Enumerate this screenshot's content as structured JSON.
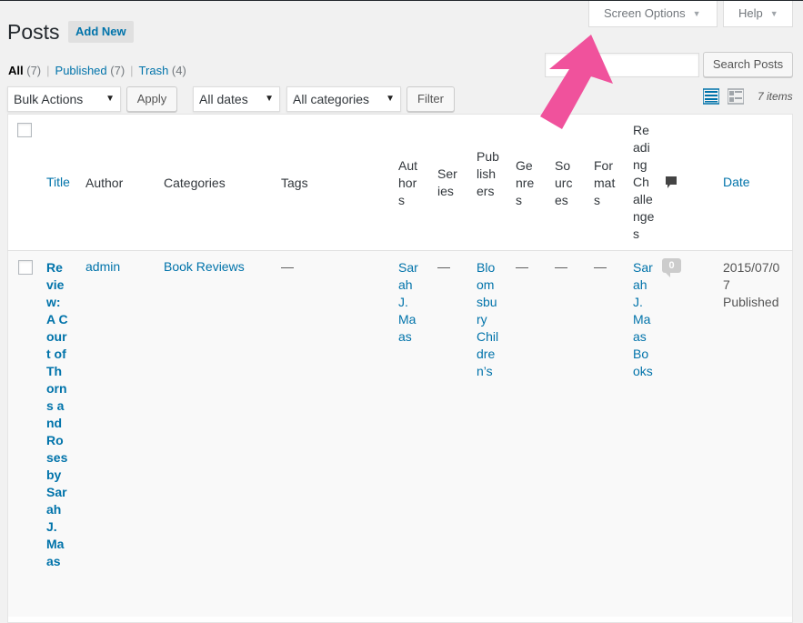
{
  "header": {
    "title": "Posts",
    "add_new": "Add New",
    "screen_options": "Screen Options",
    "help": "Help"
  },
  "filters": {
    "all": "All",
    "all_count": "(7)",
    "published": "Published",
    "published_count": "(7)",
    "trash": "Trash",
    "trash_count": "(4)"
  },
  "search": {
    "value": "",
    "button": "Search Posts"
  },
  "toolbar": {
    "bulk_actions": "Bulk Actions",
    "apply": "Apply",
    "dates": "All dates",
    "categories": "All categories",
    "filter": "Filter",
    "items_count": "7 items"
  },
  "columns": {
    "title": "Title",
    "author": "Author",
    "categories": "Categories",
    "tags": "Tags",
    "authors": "Authors",
    "series": "Series",
    "publishers": "Publishers",
    "genres": "Genres",
    "sources": "Sources",
    "formats": "Formats",
    "reading_challenges": "Reading Challenges",
    "date": "Date"
  },
  "rows": [
    {
      "title": "Review: A Court of Thorns and Roses by Sarah J. Maas",
      "author": "admin",
      "categories": "Book Reviews",
      "tags": "—",
      "authors": "Sarah J. Maas",
      "series": "—",
      "publishers": "Bloomsbury Children’s",
      "genres": "—",
      "sources": "—",
      "formats": "—",
      "reading_challenges": "Sarah J. Maas Books",
      "comments": "0",
      "date": "2015/07/07",
      "status": "Published"
    }
  ],
  "colors": {
    "link": "#0073aa",
    "arrow": "#f0529c",
    "comment_icon": "#444444"
  },
  "icons": {
    "list_view": "list-view-icon",
    "excerpt_view": "excerpt-view-icon",
    "comments": "comment-bubble-icon",
    "annotation": "pointer-arrow-icon"
  }
}
